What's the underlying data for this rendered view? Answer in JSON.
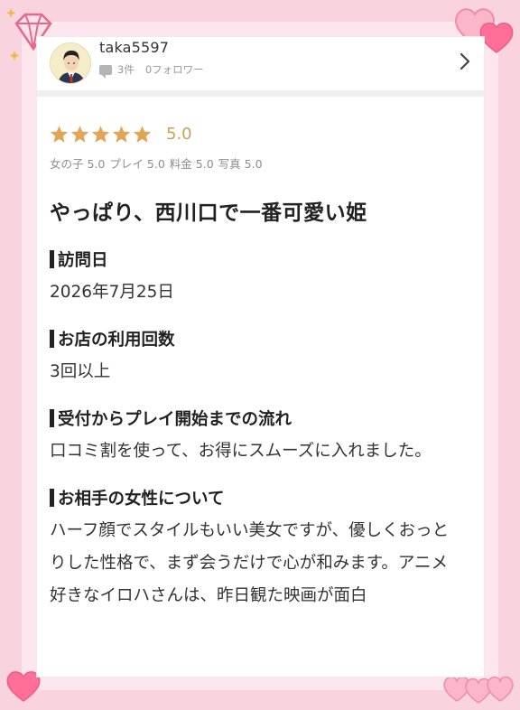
{
  "user": {
    "name": "taka5597",
    "review_count": "3件",
    "followers": "0フォロワー"
  },
  "review": {
    "stars": 5,
    "score": "5.0",
    "sub_ratings": [
      {
        "label": "女の子",
        "value": "5.0"
      },
      {
        "label": "プレイ",
        "value": "5.0"
      },
      {
        "label": "料金",
        "value": "5.0"
      },
      {
        "label": "写真",
        "value": "5.0"
      }
    ],
    "title": "やっぱり、西川口で一番可愛い姫",
    "sections": [
      {
        "label": "訪問日",
        "value": "2026年7月25日"
      },
      {
        "label": "お店の利用回数",
        "value": "3回以上"
      },
      {
        "label": "受付からプレイ開始までの流れ",
        "value": "口コミ割を使って、お得にスムーズに入れました。"
      },
      {
        "label": "お相手の女性について",
        "value": "ハーフ顔でスタイルもいい美女ですが、優しくおっとりした性格で、まず会うだけで心が和みます。アニメ好きなイロハさんは、昨日観た映画が面白"
      }
    ]
  },
  "colors": {
    "star": "#e1a558",
    "score": "#c9a259",
    "background": "#f9d3de",
    "heart": "#ff6f98"
  }
}
